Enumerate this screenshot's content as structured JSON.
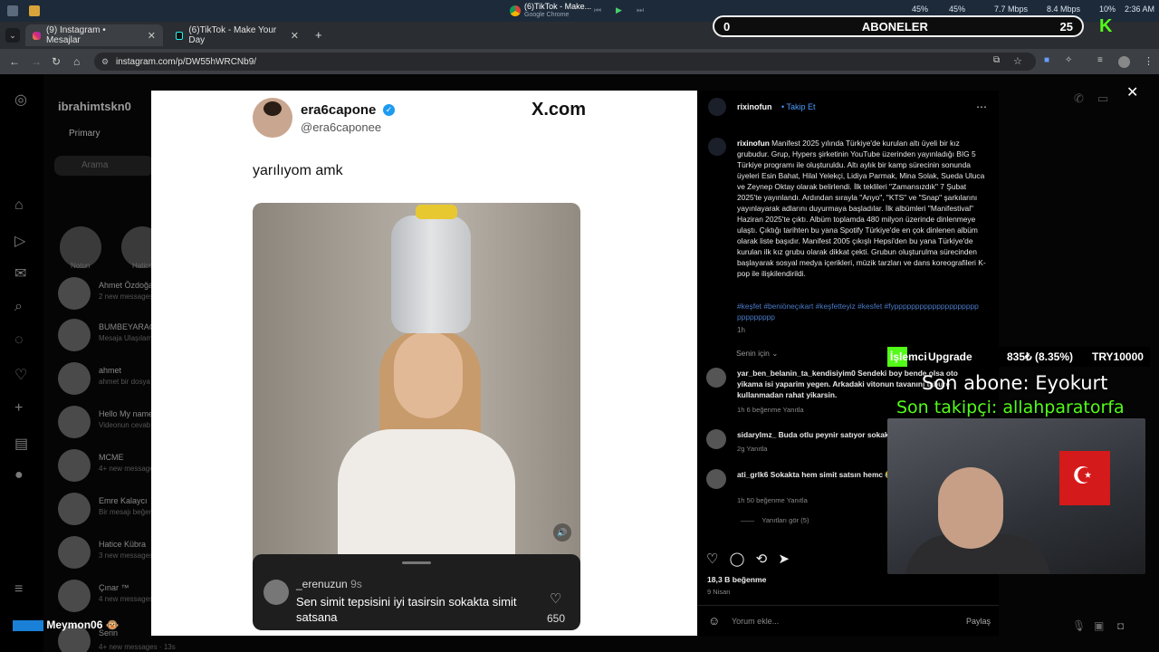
{
  "os": {
    "app_title": "(6)TikTok - Make...",
    "app_sub": "Google Chrome",
    "stats": [
      "45%",
      "45%",
      "7.7 Mbps",
      "8.4 Mbps",
      "10%",
      "2:36 AM"
    ]
  },
  "tabs": [
    {
      "label": "(9) Instagram • Mesajlar"
    },
    {
      "label": "(6)TikTok - Make Your Day"
    }
  ],
  "address": {
    "url": "instagram.com/p/DW55hWRCNb9/"
  },
  "instagram": {
    "username": "ibrahimtskn0",
    "tab_primary": "Primary",
    "search_placeholder": "Arama",
    "notes": [
      "Notun",
      "Hatice"
    ],
    "dms": [
      {
        "name": "Ahmet Özdoğan",
        "msg": "2 new messages"
      },
      {
        "name": "BUMBEYARAGA",
        "msg": "Mesaja Ulaşılam"
      },
      {
        "name": "ahmet",
        "msg": "ahmet bir dosya"
      },
      {
        "name": "Hello My name",
        "msg": "Videonun cevabı"
      },
      {
        "name": "MCME",
        "msg": "4+ new messages"
      },
      {
        "name": "Emre Kalaycı",
        "msg": "Bir mesajı beğendi"
      },
      {
        "name": "Hatice Kübra",
        "msg": "3 new messages"
      },
      {
        "name": "Çınar ™",
        "msg": "4 new messages"
      },
      {
        "name": "Serin",
        "msg": "4+ new messages · 13s"
      }
    ]
  },
  "post": {
    "tweet": {
      "name": "era6capone",
      "handle": "@era6caponee",
      "brand": "X.com",
      "text": "yarılıyom amk"
    },
    "overlay_comment": {
      "user": "_erenuzun",
      "age": "9s",
      "text": "Sen simit tepsisini iyi tasirsin sokakta simit satsana",
      "likes": "650"
    }
  },
  "panel": {
    "username": "rixinofun",
    "follow": "Takip Et",
    "caption": "Manifest 2025 yılında Türkiye'de kurulan altı üyeli bir kız grubudur. Grup, Hypers şirketinin YouTube üzerinden yayınladığı BIG 5 Türkiye programı ile oluşturuldu. Altı aylık bir kamp sürecinin sonunda üyeleri Esin Bahat, Hilal Yelekçi, Lidiya Parmak, Mina Solak, Sueda Uluca ve Zeynep Oktay olarak belirlendi. İlk teklileri \"Zamansızdık\" 7 Şubat 2025'te yayınlandı. Ardından sırayla \"Anyo\", \"KTS\" ve \"Snap\" şarkılarını yayınlayarak adlarını duyurmaya başladılar. İlk albümleri \"Manifestival\" Haziran 2025'te çıktı. Albüm toplamda 480 milyon üzerinde dinlenmeye ulaştı. Çıktığı tarihten bu yana Spotify Türkiye'de en çok dinlenen albüm olarak liste başıdır. Manifest 2005 çıkışlı Hepsi'den bu yana Türkiye'de kurulan ilk kız grubu olarak dikkat çekti. Grubun oluşturulma sürecinden başlayarak sosyal medya içerikleri, müzik tarzları ve dans koreografileri K-pop ile ilişkilendirildi.",
    "hashtags": "#keşfet #beniöneçıkart #keşfetteyiz #kesfet #fyppppppppppppppppppppppppppppp",
    "caption_time": "1h",
    "sort": "Senin için",
    "comments": [
      {
        "user": "yar_ben_belanin_ta_kendisiyim0",
        "text": "Sendeki boy bende olsa oto yikama isi yaparim yegen. Arkadaki vitonun tavanını tabure kullanmadan rahat yikarsin.",
        "meta": "1h    6 beğenme    Yanıtla"
      },
      {
        "user": "sidarylmz_",
        "text": "Buda otlu peynir satıyor sokakta",
        "meta": "2g    Yanıtla"
      },
      {
        "user": "ati_grlk6",
        "text": "Sokakta hem simit satsın hemc 😂",
        "meta": "1h    50 beğenme    Yanıtla"
      }
    ],
    "view_replies": "Yanıtları gör (5)",
    "likes": "18,3 B beğenme",
    "date": "9 Nisan",
    "add_comment": "Yorum ekle...",
    "share": "Paylaş"
  },
  "stream": {
    "subs_label": "ABONELER",
    "subs_left": "0",
    "subs_right": "25",
    "upgrade_prefix": "İşlemci",
    "upgrade": " Upgrade",
    "upgrade_progress": "835₺ (8.35%)",
    "upgrade_goal": "TRY10000",
    "last_sub": "Son abone: Eyokurt",
    "last_follow": "Son takipçi: allahparatorfa",
    "chat_user": "Meymon06"
  }
}
